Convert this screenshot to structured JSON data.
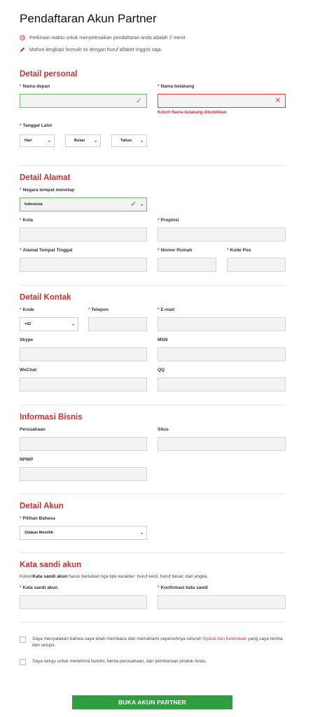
{
  "page": {
    "title": "Pendaftaran Akun Partner",
    "notes": [
      {
        "icon": "clock-icon",
        "text": "Perkiraan waktu untuk menyelesaikan pendaftaran anda adalah 2 menit"
      },
      {
        "icon": "pencil-icon",
        "text": "Mohon lengkapi formulir ini dengan huruf alfabet Inggris saja."
      }
    ]
  },
  "colors": {
    "accent": "#d32f2f",
    "success": "#2e9e3f",
    "error": "#e53935",
    "field_bg": "#f3f3f3"
  },
  "personal": {
    "title": "Detail personal",
    "first_name": {
      "label": "Nama depan",
      "value": "",
      "status": "valid"
    },
    "last_name": {
      "label": "Nama belakang",
      "value": "",
      "status": "error",
      "error": "Kolom Nama belakang dibutuhkan"
    },
    "birth": {
      "label": "Tanggal Lahir",
      "day": "Hari",
      "month": "Bulan",
      "year": "Tahun"
    }
  },
  "address": {
    "title": "Detail Alamat",
    "country": {
      "label": "Negara tempat menetap",
      "value": "Indonesia"
    },
    "city": {
      "label": "Kota"
    },
    "province": {
      "label": "Propinsi"
    },
    "street": {
      "label": "Alamat Tempat Tinggal"
    },
    "house": {
      "label": "Nomor Rumah"
    },
    "zip": {
      "label": "Kode Pos"
    }
  },
  "contact": {
    "title": "Detail Kontak",
    "code": {
      "label": "Kode",
      "value": "+62"
    },
    "phone": {
      "label": "Telepon"
    },
    "email": {
      "label": "E-mail"
    },
    "skype": {
      "label": "Skype"
    },
    "msn": {
      "label": "MSN"
    },
    "wechat": {
      "label": "WeChat"
    },
    "qq": {
      "label": "QQ"
    }
  },
  "business": {
    "title": "Informasi Bisnis",
    "company": {
      "label": "Perusahaan"
    },
    "site": {
      "label": "Situs"
    },
    "npwp": {
      "label": "NPWP"
    }
  },
  "account": {
    "title": "Detail Akun",
    "language": {
      "label": "Pilihan Bahasa",
      "value": "Silakan Memilih"
    }
  },
  "password": {
    "title": "Kata sandi akun",
    "desc_pre": "Kolom",
    "desc_bold": "Kata sandi akun",
    "desc_post": " harus berisikan tiga tipe karakter: huruf kecil, huruf besar, dan angka.",
    "pw": {
      "label": "Kata sandi akun"
    },
    "confirm": {
      "label": "Konfirmasi kata sandi"
    }
  },
  "consent": {
    "terms_pre": "Saya menyatakan bahwa saya telah membaca dan memahami sepenuhnya seluruh ",
    "terms_link": "Syarat dan Ketentuan",
    "terms_post": " yang saya terima dan setujui.",
    "newsletter": "Saya setuju untuk menerima buletin, berita perusahaan, dan pembaruan produk Anda."
  },
  "submit_label": "BUKA AKUN PARTNER"
}
